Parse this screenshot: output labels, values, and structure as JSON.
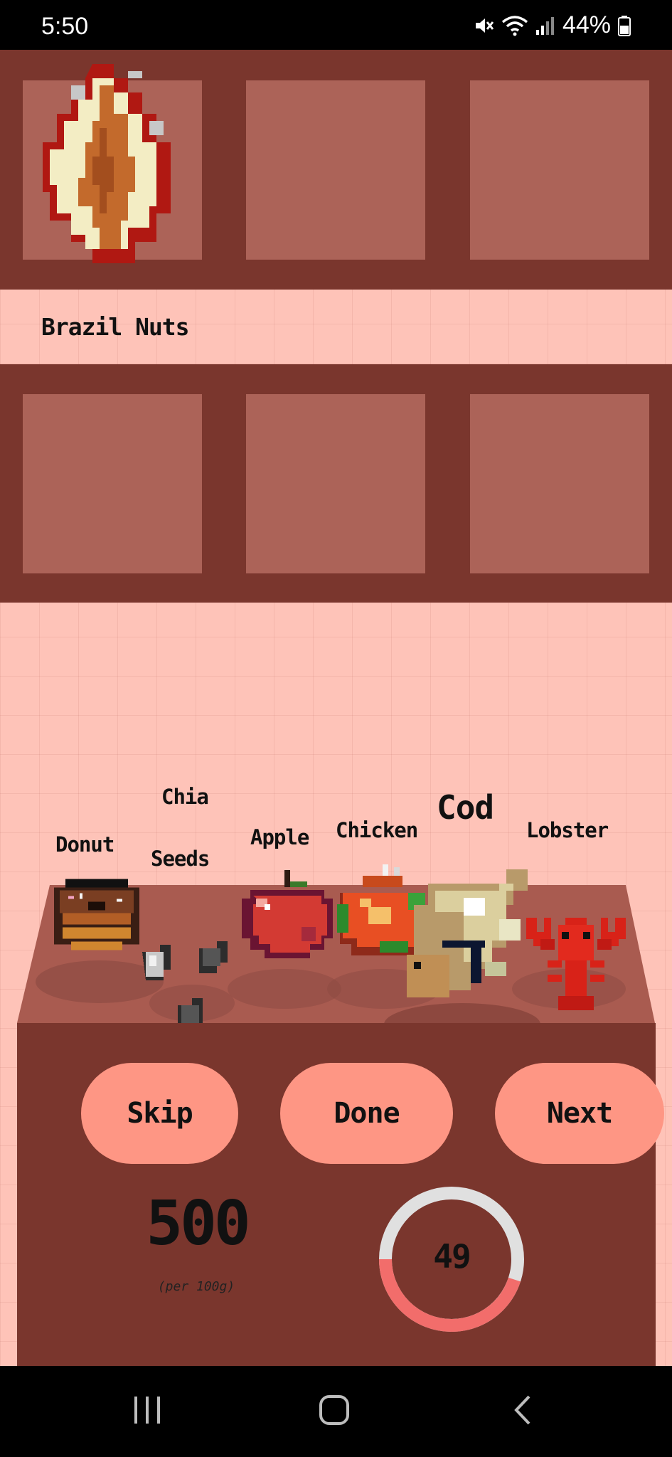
{
  "status_bar": {
    "time": "5:50",
    "battery": "44%",
    "icons": [
      "mute-icon",
      "wifi-icon",
      "signal-icon",
      "battery-icon"
    ]
  },
  "selected_item": {
    "label": "Brazil Nuts",
    "icon": "brazil-nut-icon"
  },
  "foods": [
    {
      "name": "Donut",
      "icon": "donut-icon"
    },
    {
      "name": "Chia Seeds",
      "line1": "Chia",
      "line2": "Seeds",
      "icon": "chia-seeds-icon"
    },
    {
      "name": "Apple",
      "icon": "apple-icon"
    },
    {
      "name": "Chicken",
      "icon": "chicken-icon"
    },
    {
      "name": "Cod",
      "icon": "cod-icon"
    },
    {
      "name": "Lobster",
      "icon": "lobster-icon"
    }
  ],
  "buttons": {
    "skip": "Skip",
    "done": "Done",
    "next": "Next"
  },
  "score": {
    "value": "500",
    "unit": "(per 100g)"
  },
  "timer": {
    "value": "49",
    "progress_fraction": 0.45
  },
  "colors": {
    "background": "#fec3b8",
    "shelf": "#7a362d",
    "slot": "#ac6358",
    "button": "#fe9684",
    "timer_track": "#e0e0e0",
    "timer_fill": "#f26d6b"
  }
}
